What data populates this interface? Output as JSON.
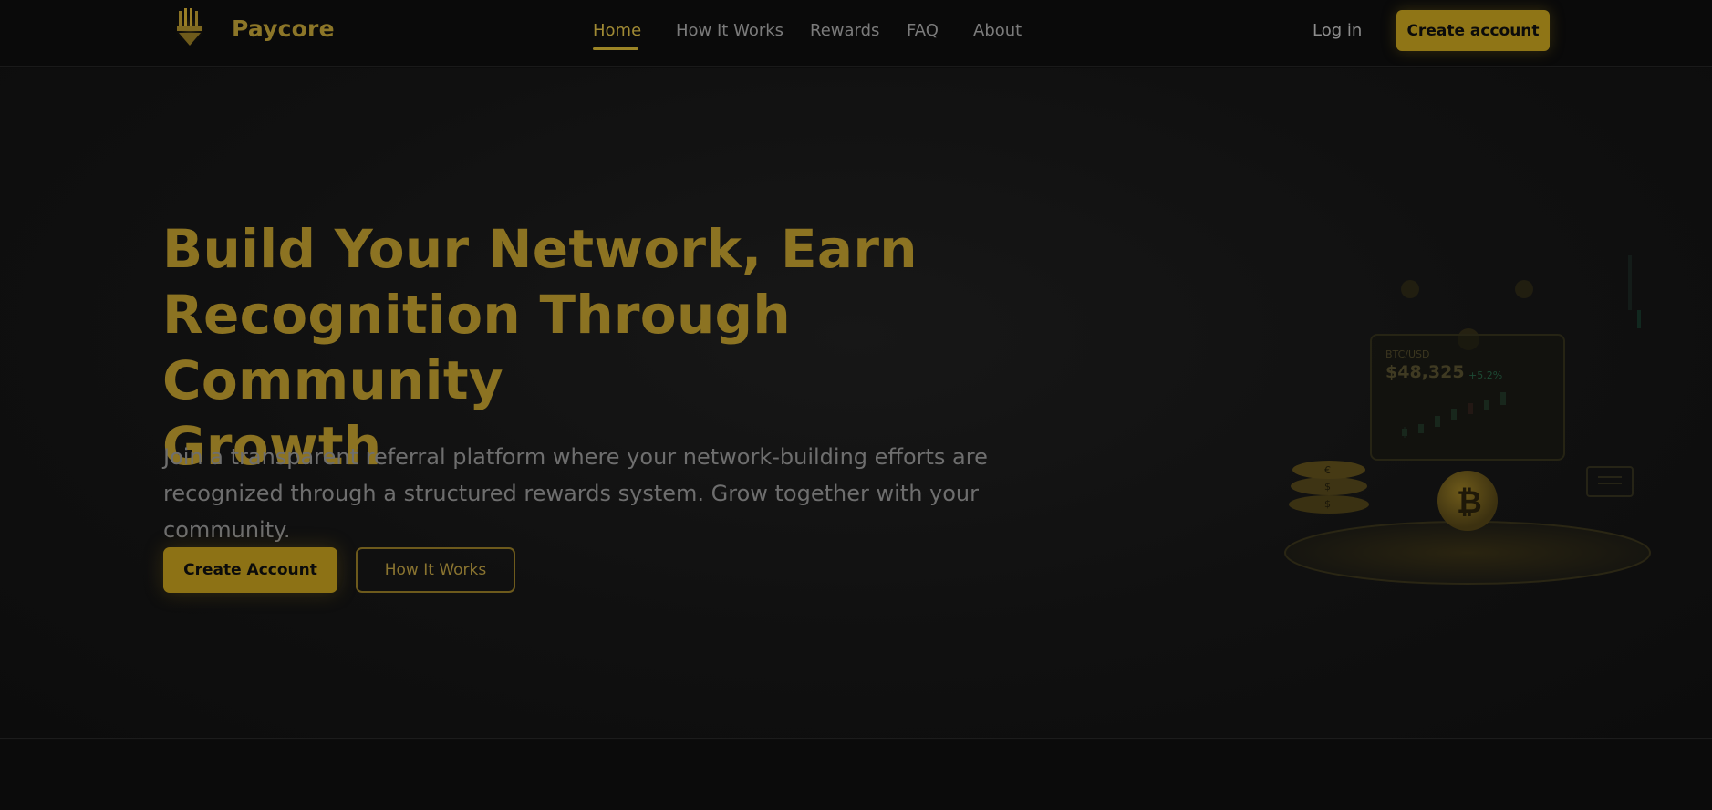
{
  "header": {
    "brand": "Paycore",
    "nav": [
      {
        "label": "Home",
        "active": true
      },
      {
        "label": "How It Works",
        "active": false
      },
      {
        "label": "Rewards",
        "active": false
      },
      {
        "label": "FAQ",
        "active": false
      },
      {
        "label": "About",
        "active": false
      }
    ],
    "login_label": "Log in",
    "create_account_label": "Create account"
  },
  "hero": {
    "title_lines": [
      "Build Your Network, Earn",
      "Recognition Through Community",
      "Growth"
    ],
    "subtitle_lines": [
      "Join a transparent referral platform where your network-building efforts are",
      "recognized through a structured rewards system. Grow together with your community."
    ],
    "primary_button": "Create Account",
    "secondary_button": "How It Works"
  },
  "illustration": {
    "pair": "BTC/USD",
    "price": "$48,325",
    "change": "+5.2%",
    "coin_symbol": "₿",
    "stack_symbols": [
      "€",
      "$",
      "$"
    ]
  },
  "colors": {
    "accent": "#8f7516",
    "background": "#0c0c0c",
    "title": "#8c7322"
  },
  "icons": [
    "crown-logo-icon",
    "bitcoin-coin-icon",
    "coin-stack-icon",
    "card-icon"
  ]
}
